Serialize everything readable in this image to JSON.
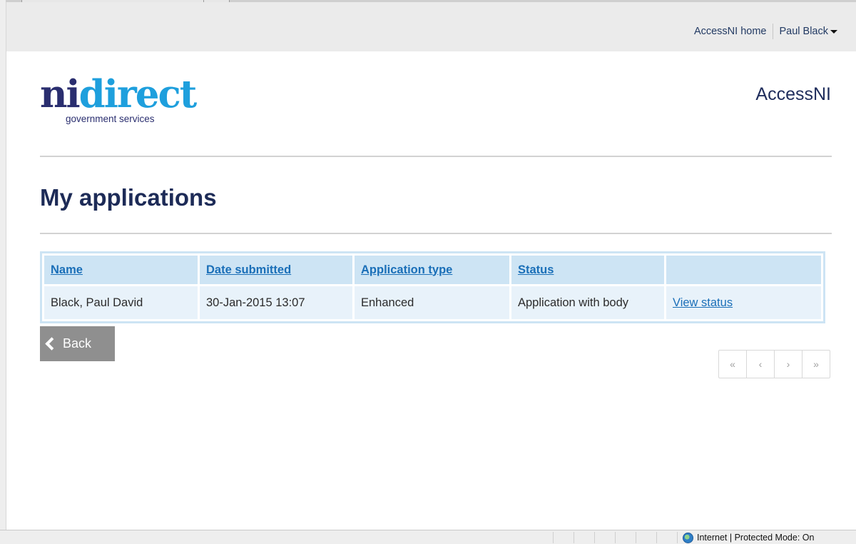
{
  "utility_nav": {
    "home_link": "AccessNI home",
    "user_menu": "Paul Black"
  },
  "header": {
    "logo_ni": "ni",
    "logo_direct": "direct",
    "logo_tagline": "government services",
    "site_name": "AccessNI"
  },
  "page": {
    "title": "My applications"
  },
  "table": {
    "headers": [
      "Name",
      "Date submitted",
      "Application type",
      "Status",
      ""
    ],
    "rows": [
      {
        "name": "Black, Paul David",
        "date_submitted": "30-Jan-2015 13:07",
        "application_type": "Enhanced",
        "status": "Application with body",
        "action": "View status"
      }
    ]
  },
  "back_button": {
    "label": "Back"
  },
  "pagination": {
    "first": "«",
    "prev": "‹",
    "next": "›",
    "last": "»"
  },
  "status_bar": {
    "zone": "Internet | Protected Mode: On"
  },
  "colors": {
    "brand_navy": "#2a2e6f",
    "brand_blue": "#1e9fdd",
    "link_blue": "#1a6fb8",
    "table_header_bg": "#cde4f4",
    "table_row_bg": "#e8f2fa"
  }
}
